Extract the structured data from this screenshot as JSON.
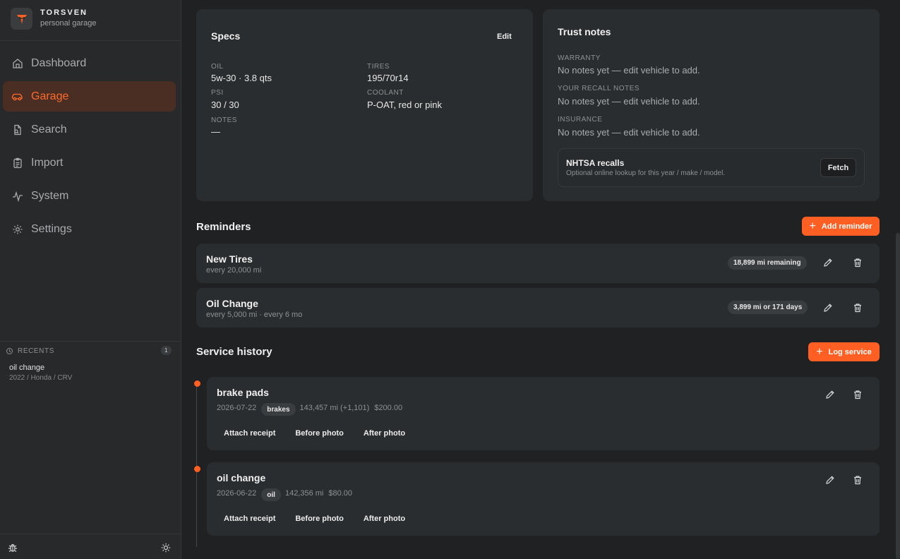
{
  "brand": {
    "name": "TORSVEN",
    "subtitle": "personal garage"
  },
  "nav": [
    {
      "label": "Dashboard",
      "icon": "home-icon",
      "active": false
    },
    {
      "label": "Garage",
      "icon": "car-icon",
      "active": true
    },
    {
      "label": "Search",
      "icon": "search-doc-icon",
      "active": false
    },
    {
      "label": "Import",
      "icon": "clipboard-icon",
      "active": false
    },
    {
      "label": "System",
      "icon": "activity-icon",
      "active": false
    },
    {
      "label": "Settings",
      "icon": "gear-icon",
      "active": false
    }
  ],
  "recents": {
    "label": "RECENTS",
    "count": "1",
    "items": [
      {
        "title": "oil change",
        "subtitle": "2022 / Honda / CRV"
      }
    ]
  },
  "specs": {
    "title": "Specs",
    "edit_label": "Edit",
    "oil_label": "OIL",
    "oil_value": "5w-30 · 3.8 qts",
    "tires_label": "TIRES",
    "tires_value": "195/70r14",
    "psi_label": "PSI",
    "psi_value": "30 / 30",
    "coolant_label": "COOLANT",
    "coolant_value": "P-OAT, red or pink",
    "notes_label": "NOTES",
    "notes_value": "—"
  },
  "trust": {
    "title": "Trust notes",
    "warranty_label": "WARRANTY",
    "warranty_value": "No notes yet — edit vehicle to add.",
    "recall_label": "YOUR RECALL NOTES",
    "recall_value": "No notes yet — edit vehicle to add.",
    "insurance_label": "INSURANCE",
    "insurance_value": "No notes yet — edit vehicle to add.",
    "nhtsa_title": "NHTSA recalls",
    "nhtsa_sub": "Optional online lookup for this year / make / model.",
    "fetch_label": "Fetch"
  },
  "reminders": {
    "title": "Reminders",
    "add_label": "Add reminder",
    "items": [
      {
        "title": "New Tires",
        "sub": "every 20,000 mi",
        "status": "18,899 mi remaining"
      },
      {
        "title": "Oil Change",
        "sub": "every 5,000 mi · every 6 mo",
        "status": "3,899 mi or 171 days"
      }
    ]
  },
  "service": {
    "title": "Service history",
    "log_label": "Log service",
    "attach_label": "Attach receipt",
    "before_label": "Before photo",
    "after_label": "After photo",
    "items": [
      {
        "title": "brake pads",
        "date": "2026-07-22",
        "tag": "brakes",
        "odometer": "143,457 mi (+1,101)",
        "cost": "$200.00"
      },
      {
        "title": "oil change",
        "date": "2026-06-22",
        "tag": "oil",
        "odometer": "142,356 mi",
        "cost": "$80.00"
      }
    ]
  },
  "colors": {
    "accent": "#ff5f22",
    "bg": "#1f2122",
    "card": "#2a2d2f",
    "sidebar": "#27292b"
  }
}
